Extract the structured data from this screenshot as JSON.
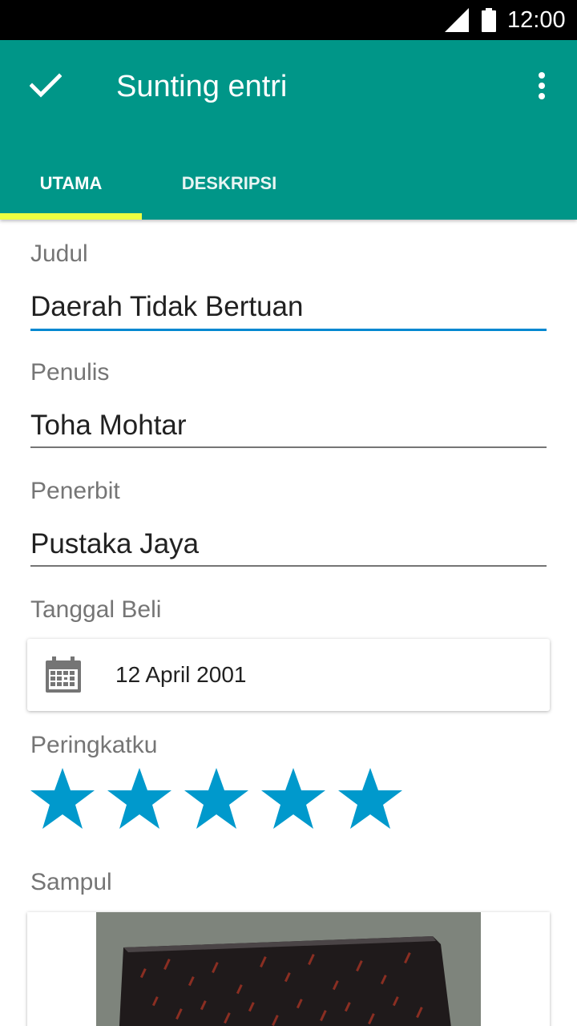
{
  "status_bar": {
    "time": "12:00",
    "signal_icon": "signal-icon",
    "battery_icon": "battery-icon"
  },
  "app_bar": {
    "title": "Sunting entri",
    "confirm_icon": "check-icon",
    "menu_icon": "more-vert-icon",
    "background_color": "#009688",
    "tabs": [
      {
        "label": "UTAMA",
        "selected": true
      },
      {
        "label": "DESKRIPSI",
        "selected": false
      }
    ],
    "tab_indicator_color": "#eeff41"
  },
  "form": {
    "title_field": {
      "label": "Judul",
      "value": "Daerah Tidak Bertuan",
      "focused": true
    },
    "author_field": {
      "label": "Penulis",
      "value": "Toha Mohtar"
    },
    "publisher_field": {
      "label": "Penerbit",
      "value": "Pustaka Jaya"
    },
    "purchase_date": {
      "label": "Tanggal Beli",
      "value": "12 April 2001",
      "icon": "calendar-icon"
    },
    "rating": {
      "label": "Peringkatku",
      "stars": 5,
      "max": 5,
      "color": "#0099cc"
    },
    "cover": {
      "label": "Sampul"
    }
  },
  "colors": {
    "accent": "#0288d1",
    "label": "#757575",
    "text": "#212121"
  }
}
